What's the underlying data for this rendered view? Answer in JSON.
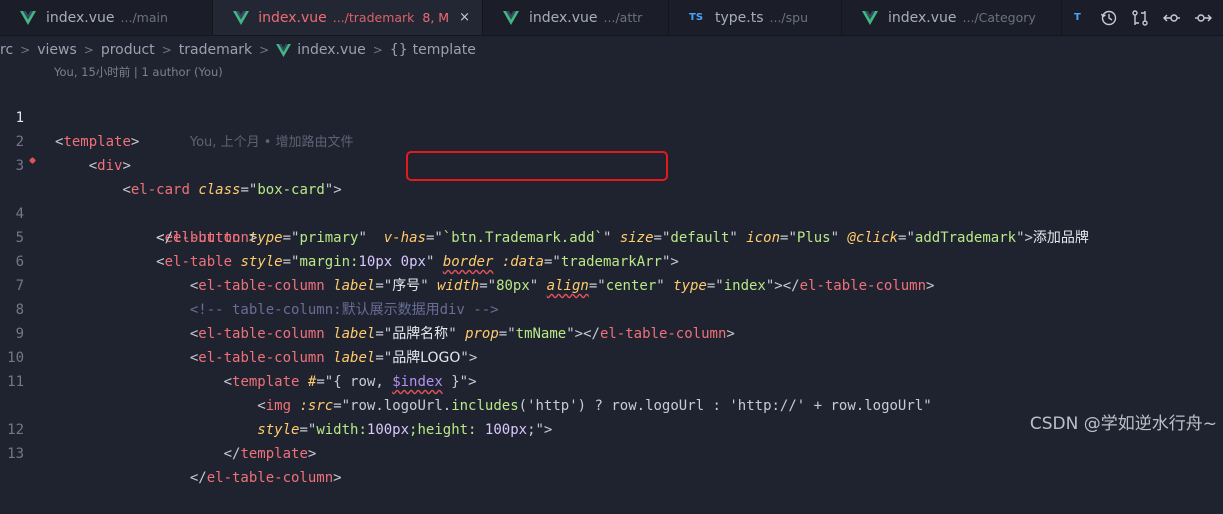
{
  "tabs": [
    {
      "file": "index.vue",
      "desc": ".../main",
      "type": "vue",
      "active": false
    },
    {
      "file": "index.vue",
      "desc": ".../trademark",
      "badge": "8, M",
      "type": "vue",
      "active": true
    },
    {
      "file": "index.vue",
      "desc": ".../attr",
      "type": "vue",
      "active": false
    },
    {
      "file": "type.ts",
      "desc": ".../spu",
      "type": "ts",
      "active": false
    },
    {
      "file": "index.vue",
      "desc": ".../Category",
      "type": "vue",
      "active": false
    }
  ],
  "ts_label": "TS",
  "breadcrumb": {
    "items": [
      "rc",
      "views",
      "product",
      "trademark",
      "index.vue",
      "template"
    ],
    "braces": "{}"
  },
  "codelens": "You, 15小时前 | 1 author (You)",
  "ghost_blame": "You, 上个月 • 增加路由文件",
  "line_numbers": [
    "1",
    "2",
    "3",
    "4",
    "",
    "5",
    "6",
    "7",
    "8",
    "9",
    "10",
    "11",
    "",
    "12",
    "13"
  ],
  "code": {
    "l1_tag": "template",
    "l2_tag": "div",
    "l3_tag": "el-card",
    "l3_attr": "class",
    "l3_val": "box-card",
    "l4_tag": "el-button",
    "l4_type": "type",
    "l4_type_val": "primary",
    "l4_vhas": "v-has",
    "l4_vhas_val": "`btn.Trademark.add`",
    "l4_size": "size",
    "l4_size_val": "default",
    "l4_icon": "icon",
    "l4_icon_val": "Plus",
    "l4_click": "@click",
    "l4_click_val": "addTrademark",
    "l4_text": "添加品牌",
    "l4b_tag": "el-button",
    "l5_tag": "el-table",
    "l5_style": "style",
    "l5_style_val_a": "margin:",
    "l5_style_val_b": "10px 0px",
    "l5_border": "border",
    "l5_data": ":data",
    "l5_data_val": "trademarkArr",
    "l6_tag": "el-table-column",
    "l6_label": "label",
    "l6_label_val": "序号",
    "l6_width": "width",
    "l6_width_val": "80px",
    "l6_align": "align",
    "l6_align_val": "center",
    "l6_type": "type",
    "l6_type_val": "index",
    "l7_comment": "<!-- table-column:默认展示数据用div -->",
    "l8_tag": "el-table-column",
    "l8_label": "label",
    "l8_label_val": "品牌名称",
    "l8_prop": "prop",
    "l8_prop_val": "tmName",
    "l9_tag": "el-table-column",
    "l9_label": "label",
    "l9_label_val": "品牌LOGO",
    "l10_tag": "template",
    "l10_slot": "#",
    "l10_val_a": "{ row, ",
    "l10_val_b": "$index",
    "l10_val_c": " }",
    "l11_tag": "img",
    "l11_src": ":src",
    "l11_val_a": "row.logoUrl.",
    "l11_val_b": "includes",
    "l11_val_c": "('http') ? row.logoUrl : 'http://' + row.logoUrl",
    "l11b_style": "style",
    "l11b_val_a": "width:",
    "l11b_val_b": "100px",
    "l11b_val_c": ";height: ",
    "l11b_val_d": "100px",
    "l11b_val_e": ";",
    "l12_tag": "template",
    "l13_tag": "el-table-column"
  },
  "watermark": "CSDN @学如逆水行舟~"
}
